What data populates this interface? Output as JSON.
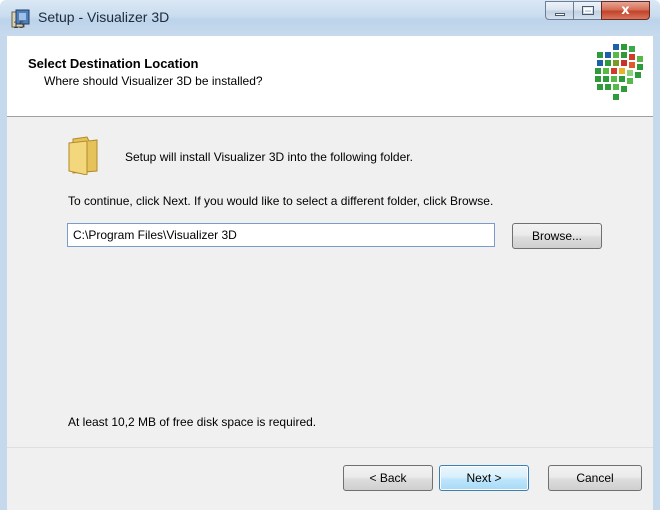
{
  "window": {
    "title": "Setup - Visualizer 3D",
    "caption_buttons": {
      "minimize": "minimize-icon",
      "maximize": "maximize-icon",
      "close": "x"
    }
  },
  "header": {
    "title": "Select Destination Location",
    "subtitle": "Where should Visualizer 3D be installed?"
  },
  "content": {
    "intro": "Setup will install Visualizer 3D into the following folder.",
    "continue": "To continue, click Next. If you would like to select a different folder, click Browse.",
    "path_value": "C:\\Program Files\\Visualizer 3D",
    "browse_label": "Browse...",
    "disk_space": "At least 10,2 MB of free disk space is required."
  },
  "footer": {
    "back_label": "< Back",
    "next_label": "Next >",
    "cancel_label": "Cancel"
  },
  "colors": {
    "close_button": "#c2432a",
    "default_button_border": "#3c7fb1",
    "input_border": "#7a9cc8"
  }
}
